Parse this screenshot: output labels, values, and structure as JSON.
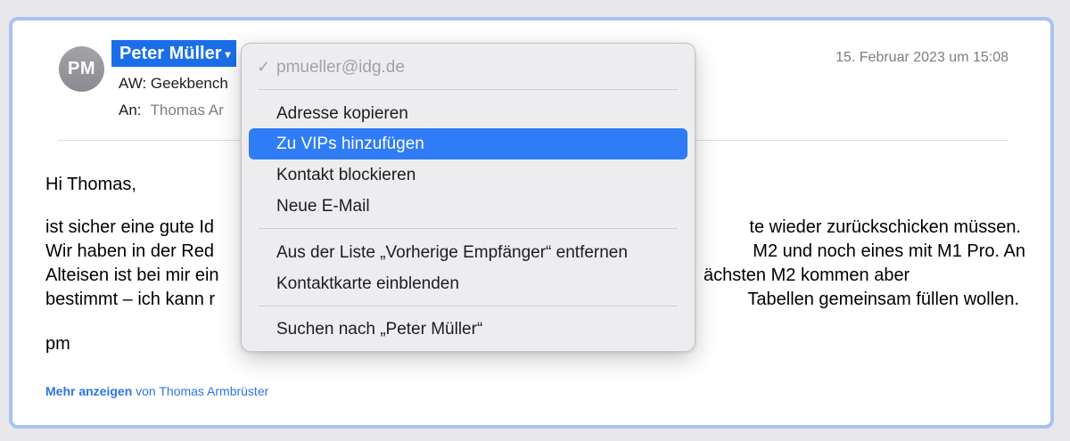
{
  "header": {
    "avatar_initials": "PM",
    "sender_name": "Peter Müller",
    "subject": "AW: Geekbench",
    "to_label": "An:",
    "to_name": "Thomas Ar",
    "date": "15. Februar 2023 um 15:08"
  },
  "body": {
    "greeting": "Hi Thomas,",
    "paragraph": "ist sicher eine gute Id                                                                                te wieder zurückschicken müssen.\nWir haben in der Red                                                                                M2 und noch eines mit M1 Pro. An\nAlteisen ist bei mir ein                                                                               ächsten M2 kommen aber\nbestimmt – ich kann r                                                                                Tabellen gemeinsam füllen wollen.",
    "paragraph_lines": [
      "ist sicher eine gute Id",
      "te wieder zurückschicken müssen.",
      "Wir haben in der Red",
      "M2 und noch eines mit M1 Pro. An",
      "Alteisen ist bei mir ein",
      "ächsten M2 kommen aber",
      "bestimmt – ich kann r",
      "Tabellen gemeinsam füllen wollen."
    ],
    "signature": "pm"
  },
  "footer": {
    "more_label": "Mehr anzeigen",
    "more_suffix": "von Thomas Armbrüster"
  },
  "context_menu": {
    "email": "pmueller@idg.de",
    "checkmark": "✓",
    "items": [
      "Adresse kopieren",
      "Zu VIPs hinzufügen",
      "Kontakt blockieren",
      "Neue E-Mail",
      "Aus der Liste „Vorherige Empfänger“ entfernen",
      "Kontaktkarte einblenden",
      "Suchen nach „Peter Müller“"
    ],
    "highlighted_index": 1
  },
  "colors": {
    "accent": "#1a6fe8",
    "highlight": "#2f7cf6",
    "link": "#2f73e6",
    "window_border": "#a8c2f2"
  }
}
